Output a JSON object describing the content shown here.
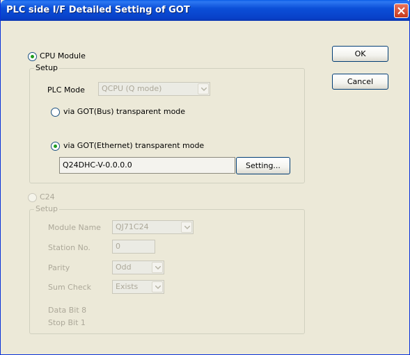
{
  "window": {
    "title": "PLC side I/F Detailed Setting of GOT"
  },
  "buttons": {
    "ok": "OK",
    "cancel": "Cancel"
  },
  "cpu_module": {
    "radio_label": "CPU Module",
    "selected": true,
    "setup_title": "Setup",
    "plc_mode_label": "PLC Mode",
    "plc_mode_value": "QCPU (Q mode)",
    "bus_mode_label": "via GOT(Bus) transparent mode",
    "ethernet_mode_label": "via GOT(Ethernet) transparent mode",
    "ethernet_selected": true,
    "ethernet_target_value": "Q24DHC-V-0.0.0.0",
    "setting_button": "Setting..."
  },
  "c24": {
    "radio_label": "C24",
    "selected": false,
    "setup_title": "Setup",
    "module_name_label": "Module Name",
    "module_name_value": "QJ71C24",
    "station_no_label": "Station No.",
    "station_no_value": "0",
    "parity_label": "Parity",
    "parity_value": "Odd",
    "sum_check_label": "Sum Check",
    "sum_check_value": "Exists",
    "data_bit_text": "Data Bit  8",
    "stop_bit_text": "Stop Bit  1"
  }
}
